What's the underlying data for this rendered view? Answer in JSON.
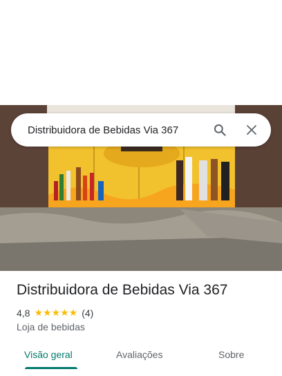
{
  "search": {
    "query": "Distribuidora de Bebidas Via 367"
  },
  "place": {
    "name": "Distribuidora de Bebidas Via 367",
    "rating": "4,8",
    "stars": "★★★★★",
    "review_count": "(4)",
    "category": "Loja de bebidas"
  },
  "tabs": [
    {
      "label": "Visão geral",
      "active": true
    },
    {
      "label": "Avaliações",
      "active": false
    },
    {
      "label": "Sobre",
      "active": false
    }
  ],
  "colors": {
    "accent": "#00796b",
    "star": "#fbbc04",
    "text": "#202124"
  },
  "icons": {
    "search": "search-icon",
    "close": "close-icon"
  }
}
